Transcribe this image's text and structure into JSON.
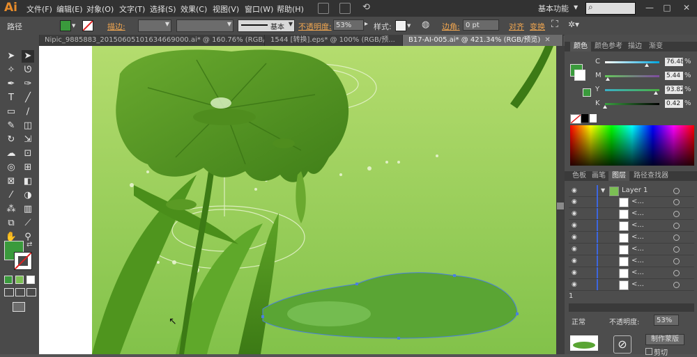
{
  "app": {
    "logo": "Ai",
    "menus": [
      "文件(F)",
      "编辑(E)",
      "对象(O)",
      "文字(T)",
      "选择(S)",
      "效果(C)",
      "视图(V)",
      "窗口(W)",
      "帮助(H)"
    ],
    "workspace": "基本功能",
    "window_controls": [
      "—",
      "□",
      "✕"
    ]
  },
  "control_bar": {
    "selection_label": "路径",
    "fill_color": "#3a9a3c",
    "stroke_label": "描边:",
    "brush_label": "基本",
    "opacity_label": "不透明度:",
    "opacity_value": "53%",
    "style_label": "样式:",
    "corner_label": "边角:",
    "corner_value": "0 pt",
    "align_label": "对齐",
    "transform_label": "变换"
  },
  "tabs": [
    {
      "label": "Nipic_9885883_20150605101634669000.ai* @ 160.76% (RGB/...",
      "active": false
    },
    {
      "label": "1544 [转换].eps* @ 100% (RGB/预...",
      "active": false
    },
    {
      "label": "B17-AI-005.ai* @ 421.34% (RGB/预览)",
      "active": true
    }
  ],
  "tab_close": "✕",
  "color_panel": {
    "tabs": [
      "颜色",
      "颜色参考",
      "描边",
      "渐变"
    ],
    "active_tab": "颜色",
    "channels": [
      {
        "label": "C",
        "value": "76.48",
        "fraction": 0.7648,
        "gradient": "linear-gradient(to right,#ffffff,#00a6de)"
      },
      {
        "label": "M",
        "value": "5.44",
        "fraction": 0.0544,
        "gradient": "linear-gradient(to right,#64c85a,#7f4aa0)"
      },
      {
        "label": "Y",
        "value": "93.82",
        "fraction": 0.9382,
        "gradient": "linear-gradient(to right,#3ab0c8,#4ab040)"
      },
      {
        "label": "K",
        "value": "0.42",
        "fraction": 0.0042,
        "gradient": "linear-gradient(to right,#3aa040,#000000)"
      }
    ],
    "current_color": "#3a9a3c"
  },
  "layers_panel": {
    "tabs": [
      "色板",
      "画笔",
      "图层",
      "路径查找器"
    ],
    "active_tab": "图层",
    "layer_name": "Layer 1",
    "sublayers": [
      "<...",
      "<...",
      "<...",
      "<...",
      "<...",
      "<...",
      "<...",
      "<..."
    ],
    "bottom_label": "1",
    "toggle_label": "正常",
    "opacity_label": "不透明度:",
    "opacity_value": "53%",
    "make_mask": "制作蒙版",
    "clip": "剪切"
  },
  "colors": {
    "menubar": "#323232",
    "panel": "#4d4d4d",
    "leaf_dark": "#4f8f1c",
    "leaf_light": "#86c23f",
    "bg_top": "#b4dc6e",
    "bg_bottom": "#82c24a"
  }
}
